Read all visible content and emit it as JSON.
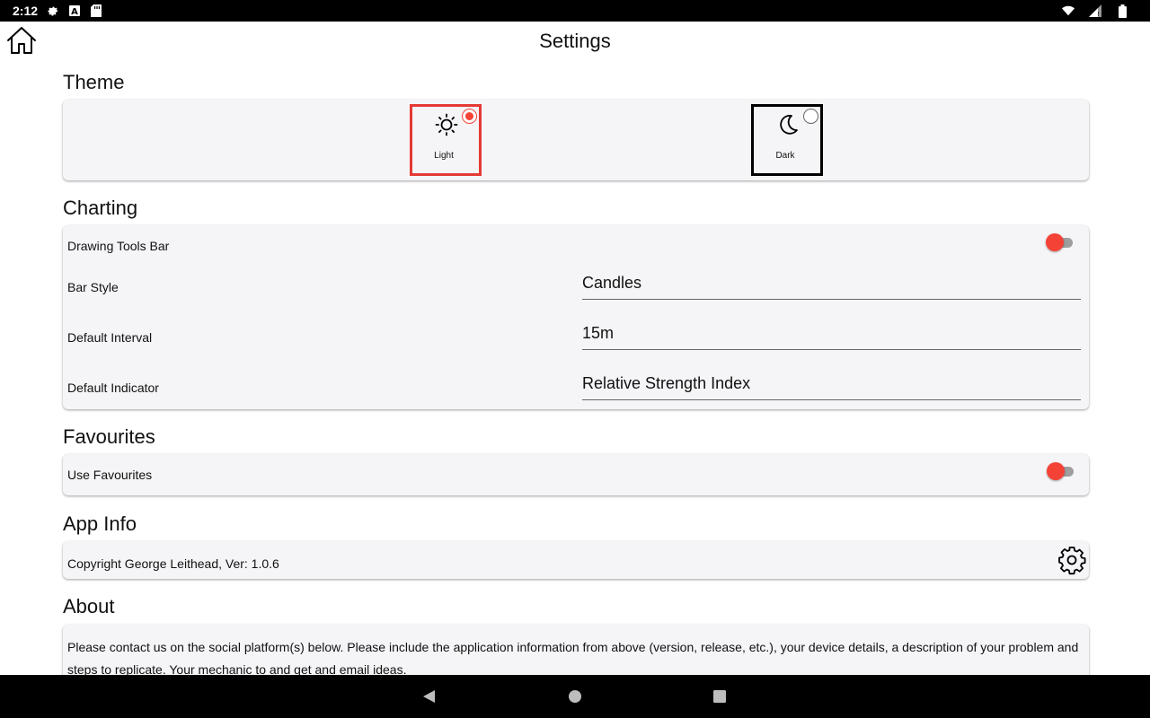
{
  "status_bar": {
    "time": "2:12",
    "icons": [
      "settings-icon",
      "a-badge-icon",
      "sd-card-icon",
      "wifi-icon",
      "signal-icon",
      "battery-icon"
    ]
  },
  "header": {
    "title": "Settings",
    "home_icon": "home-icon"
  },
  "theme": {
    "section_title": "Theme",
    "options": [
      {
        "label": "Light",
        "icon": "sun-icon",
        "selected": true
      },
      {
        "label": "Dark",
        "icon": "moon-icon",
        "selected": false
      }
    ]
  },
  "charting": {
    "section_title": "Charting",
    "drawing_tools_label": "Drawing Tools Bar",
    "drawing_tools_on": false,
    "bar_style_label": "Bar Style",
    "bar_style_value": "Candles",
    "default_interval_label": "Default Interval",
    "default_interval_value": "15m",
    "default_indicator_label": "Default Indicator",
    "default_indicator_value": "Relative Strength Index"
  },
  "favourites": {
    "section_title": "Favourites",
    "use_favourites_label": "Use Favourites",
    "use_favourites_on": false
  },
  "app_info": {
    "section_title": "App Info",
    "copyright": "Copyright George Leithead, Ver: 1.0.6",
    "icon": "gear-icon"
  },
  "about": {
    "section_title": "About",
    "text": "Please contact us on the social platform(s) below.  Please include the application information from above (version, release, etc.), your device details, a description of your problem and steps to replicate. Your mechanic to and get and email ideas."
  },
  "nav_bar": {
    "buttons": [
      "back-icon",
      "home-circle-icon",
      "recents-icon"
    ]
  },
  "colors": {
    "accent": "#f44336",
    "selected_border": "#e53935",
    "card_bg": "#f5f5f7",
    "system_bar": "#000000"
  }
}
